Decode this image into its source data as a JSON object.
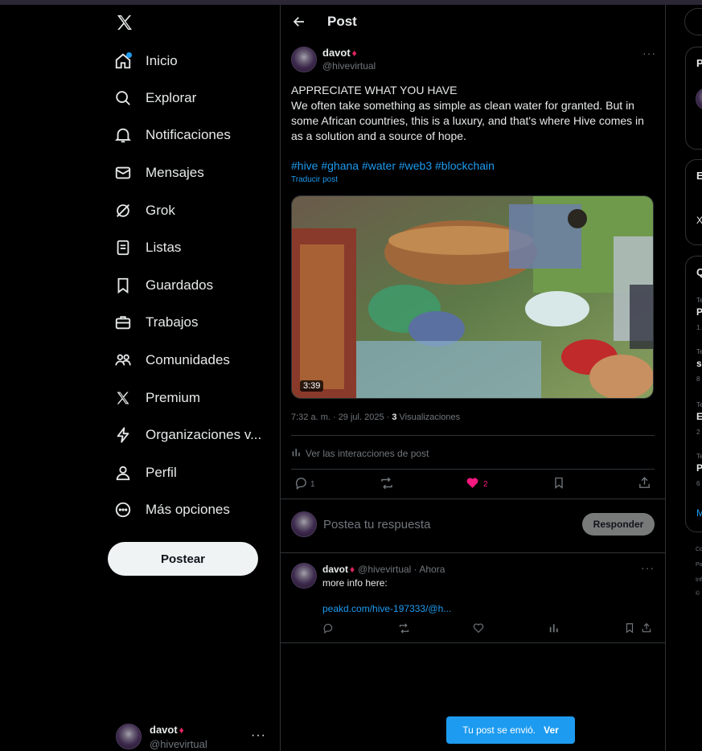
{
  "nav": {
    "items": [
      {
        "label": "Inicio",
        "icon": "home-icon"
      },
      {
        "label": "Explorar",
        "icon": "search-icon"
      },
      {
        "label": "Notificaciones",
        "icon": "bell-icon"
      },
      {
        "label": "Mensajes",
        "icon": "envelope-icon"
      },
      {
        "label": "Grok",
        "icon": "grok-icon"
      },
      {
        "label": "Listas",
        "icon": "list-icon"
      },
      {
        "label": "Guardados",
        "icon": "bookmark-icon"
      },
      {
        "label": "Trabajos",
        "icon": "briefcase-icon"
      },
      {
        "label": "Comunidades",
        "icon": "people-icon"
      },
      {
        "label": "Premium",
        "icon": "x-logo-icon"
      },
      {
        "label": "Organizaciones v...",
        "icon": "lightning-icon"
      },
      {
        "label": "Perfil",
        "icon": "person-icon"
      },
      {
        "label": "Más opciones",
        "icon": "more-circle-icon"
      }
    ],
    "post_button": "Postear"
  },
  "account": {
    "name": "davot",
    "handle": "@hivevirtual"
  },
  "header": {
    "title": "Post"
  },
  "tweet": {
    "name": "davot",
    "handle": "@hivevirtual",
    "line1": "APPRECIATE WHAT YOU HAVE",
    "body": "We often take something as simple as clean water for granted. But in some African countries, this is a luxury, and that's where Hive comes in as a solution and a source of hope.",
    "hashtags": "#hive #ghana #water #web3 #blockchain",
    "translate": "Traducir post",
    "video_duration": "3:39",
    "time": "7:32 a. m. · 29 jul. 2025 · ",
    "views_count": "3",
    "views_label": " Visualizaciones",
    "interactions": "Ver las interacciones de post",
    "replies": "1",
    "likes": "2"
  },
  "reply_box": {
    "placeholder": "Postea tu respuesta",
    "button": "Responder"
  },
  "reply": {
    "name": "davot",
    "meta": "@hivevirtual · Ahora",
    "text": "more info here:",
    "link": "peakd.com/hive-197333/@h..."
  },
  "toast": {
    "message": "Tu post se envió.",
    "action": "Ver"
  },
  "right_sidebar": {
    "card1_initial": "P",
    "card2_initial": "E",
    "card2_text": "X",
    "card3_initial": "Q",
    "trends": [
      {
        "top": "Te",
        "title": "P",
        "sub": "1."
      },
      {
        "top": "Te",
        "title": "s",
        "sub": "8"
      },
      {
        "top": "Te",
        "title": "E",
        "sub": "2"
      },
      {
        "top": "Te",
        "title": "P",
        "sub": "6"
      }
    ],
    "more": "M",
    "footer": [
      "Co",
      "Po",
      "Inf",
      "©"
    ]
  },
  "colors": {
    "accent": "#1d9bf0",
    "like": "#f91880",
    "border": "#2f3336",
    "muted": "#71767b"
  }
}
